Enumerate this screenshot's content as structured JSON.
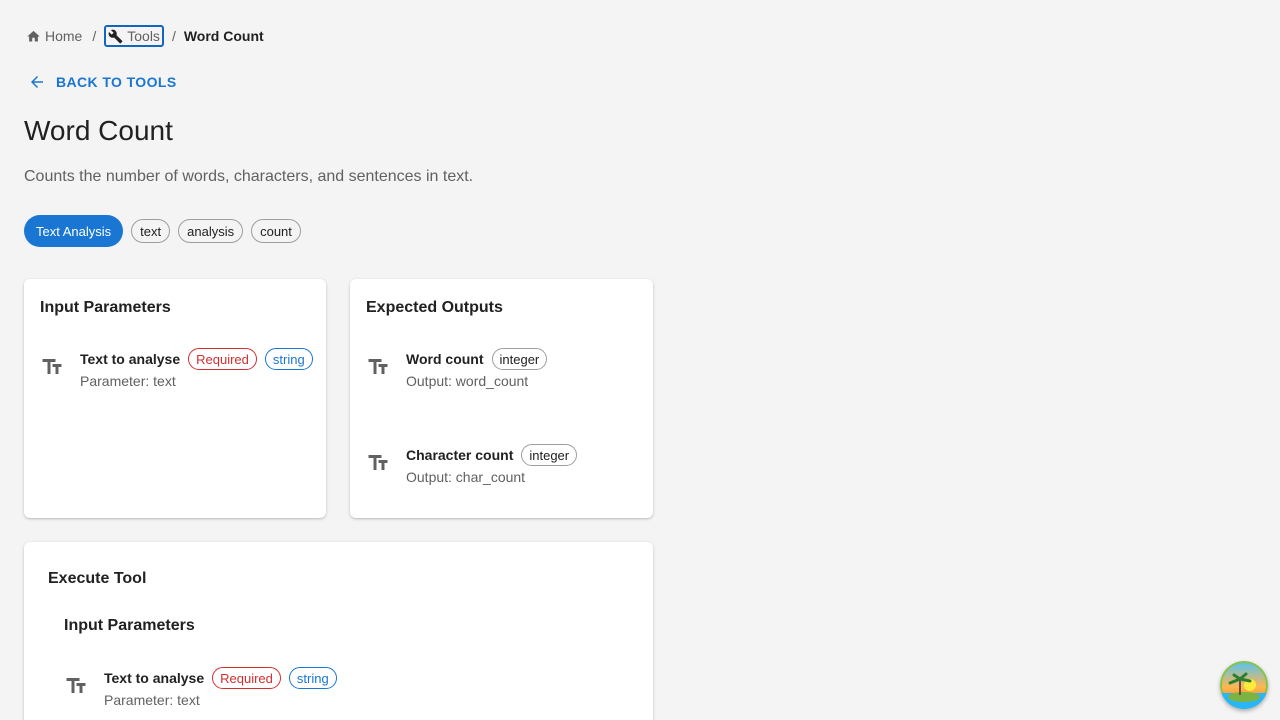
{
  "breadcrumb": {
    "home": "Home",
    "tools": "Tools",
    "current": "Word Count",
    "separator": "/"
  },
  "back_link": "BACK TO TOOLS",
  "page": {
    "title": "Word Count",
    "description": "Counts the number of words, characters, and sentences in text."
  },
  "chips": {
    "category": "Text Analysis",
    "tags": [
      "text",
      "analysis",
      "count"
    ]
  },
  "input_card": {
    "title": "Input Parameters",
    "params": [
      {
        "name": "Text to analyse",
        "required": "Required",
        "type": "string",
        "sub": "Parameter: text"
      }
    ]
  },
  "output_card": {
    "title": "Expected Outputs",
    "outputs": [
      {
        "name": "Word count",
        "type": "integer",
        "sub": "Output: word_count"
      },
      {
        "name": "Character count",
        "type": "integer",
        "sub": "Output: char_count"
      }
    ]
  },
  "execute_card": {
    "title": "Execute Tool",
    "section_title": "Input Parameters",
    "params": [
      {
        "name": "Text to analyse",
        "required": "Required",
        "type": "string",
        "sub": "Parameter: text"
      }
    ]
  },
  "colors": {
    "primary": "#1976d2",
    "required": "#d32f2f",
    "background": "#f4f4f4"
  },
  "icons": {
    "home": "home-icon",
    "tools": "wrench-icon",
    "back": "arrow-left-icon",
    "param": "text-fields-icon",
    "avatar": "island-avatar"
  }
}
